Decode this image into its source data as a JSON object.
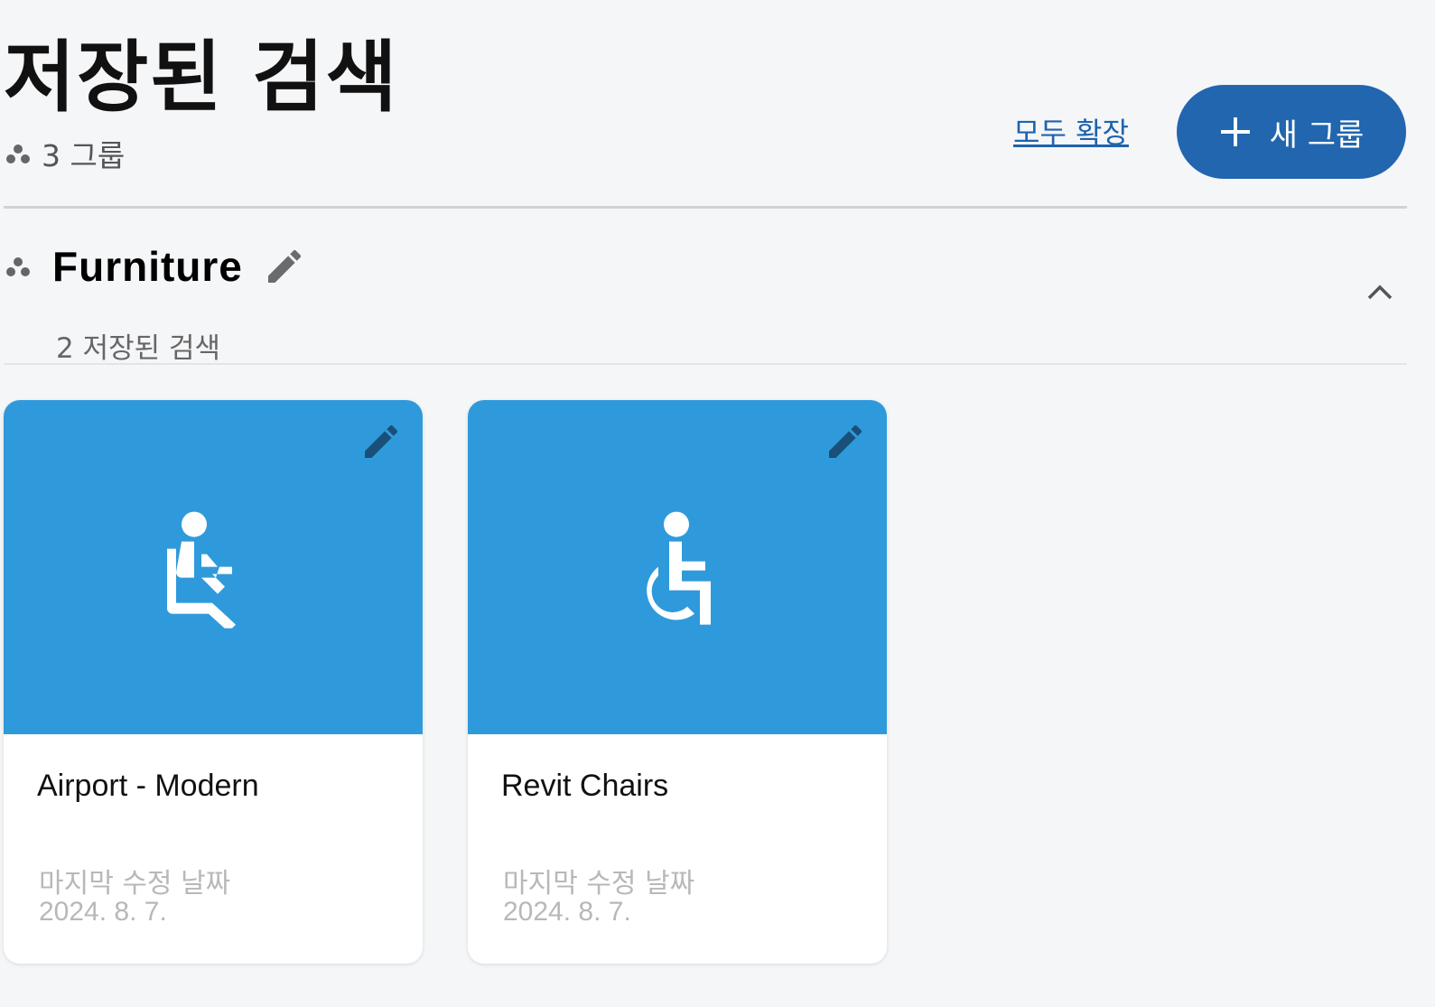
{
  "header": {
    "title": "저장된 검색",
    "group_count": "3 그룹",
    "expand_all_label": "모두 확장",
    "new_group_label": "새 그룹"
  },
  "groups": [
    {
      "name": "Furniture",
      "saved_count": "2 저장된 검색",
      "cards": [
        {
          "title": "Airport - Modern",
          "icon": "seated-person-icon",
          "meta_label": "마지막 수정 날짜",
          "meta_date": "2024. 8. 7."
        },
        {
          "title": "Revit Chairs",
          "icon": "wheelchair-icon",
          "meta_label": "마지막 수정 날짜",
          "meta_date": "2024. 8. 7."
        }
      ]
    }
  ],
  "colors": {
    "primary_button": "#2166ae",
    "link": "#1f63ad",
    "card_banner": "#2f9adb",
    "background": "#f5f6f8"
  }
}
